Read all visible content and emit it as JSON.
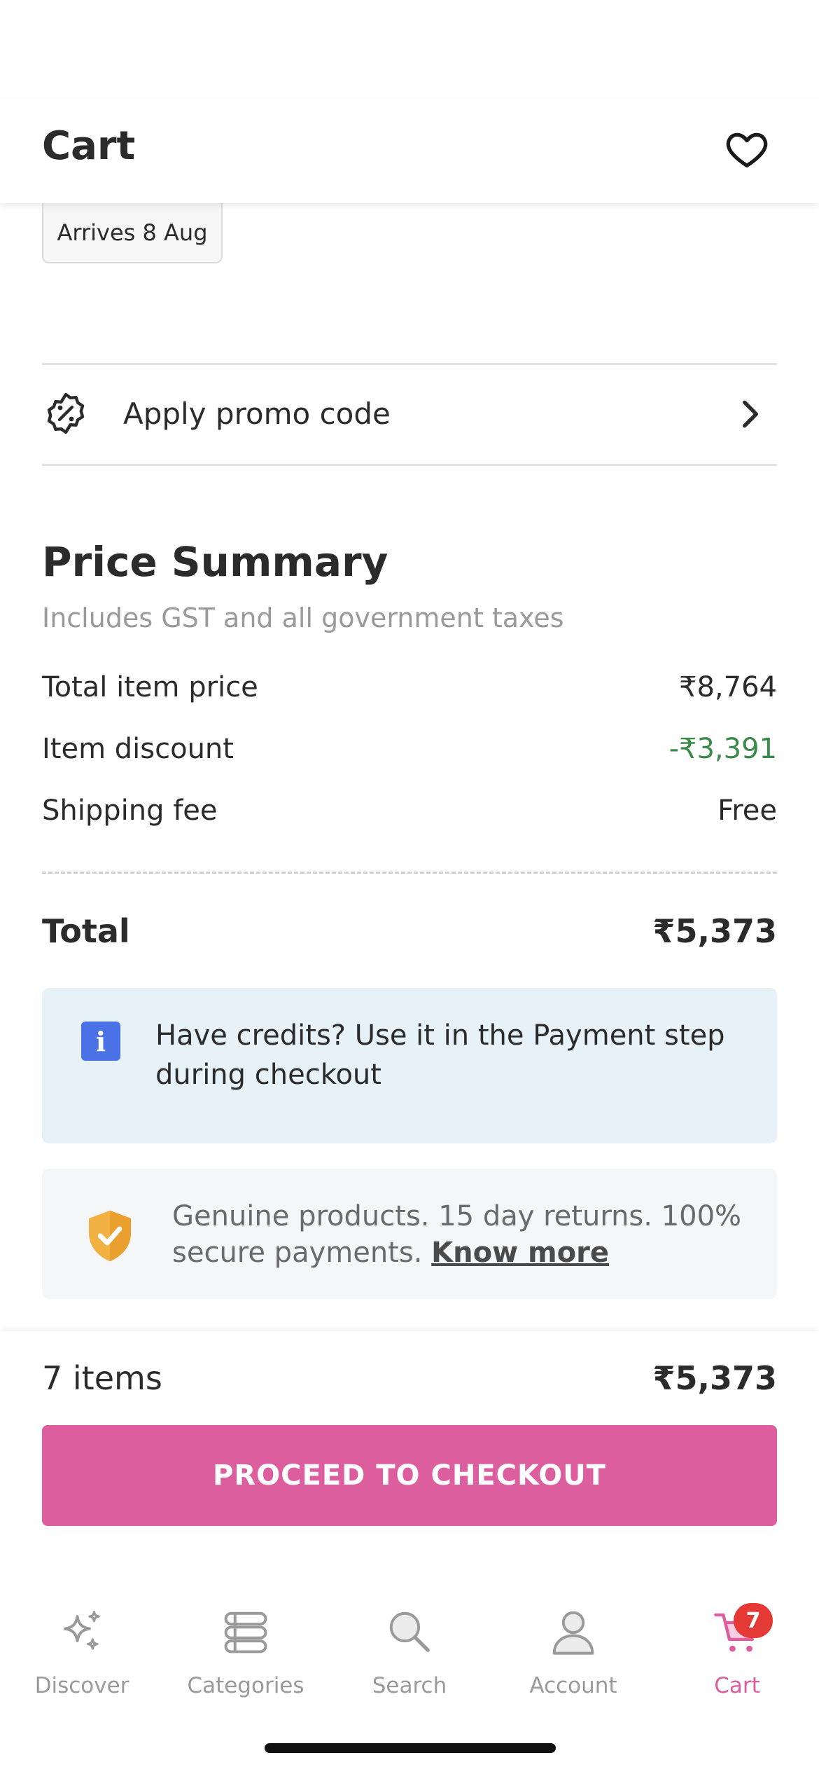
{
  "header": {
    "title": "Cart"
  },
  "cart_item": {
    "arrives": "Arrives 8 Aug"
  },
  "promo": {
    "label": "Apply promo code"
  },
  "summary": {
    "title": "Price Summary",
    "subtitle": "Includes GST and all government taxes",
    "rows": [
      {
        "label": "Total item price",
        "value": "₹8,764"
      },
      {
        "label": "Item discount",
        "value": "-₹3,391"
      },
      {
        "label": "Shipping fee",
        "value": "Free"
      }
    ],
    "total_label": "Total",
    "total_value": "₹5,373"
  },
  "credits": {
    "text": "Have credits? Use it in the Payment step during checkout"
  },
  "genuine": {
    "text": "Genuine products. 15 day returns. 100% secure payments.",
    "link": "Know more"
  },
  "footer": {
    "items_count": "7 items",
    "price": "₹5,373",
    "checkout_label": "PROCEED TO CHECKOUT"
  },
  "tabs": [
    {
      "label": "Discover",
      "icon": "sparkle-icon"
    },
    {
      "label": "Categories",
      "icon": "list-icon"
    },
    {
      "label": "Search",
      "icon": "search-icon"
    },
    {
      "label": "Account",
      "icon": "user-icon"
    },
    {
      "label": "Cart",
      "icon": "cart-icon",
      "badge": "7"
    }
  ],
  "colors": {
    "brand": "#dc5e9f",
    "discount": "#3b8a4a",
    "info_bg": "#e6f2f8",
    "info_icon": "#4a72e6",
    "badge": "#e53935",
    "shield": "#f2b243"
  }
}
